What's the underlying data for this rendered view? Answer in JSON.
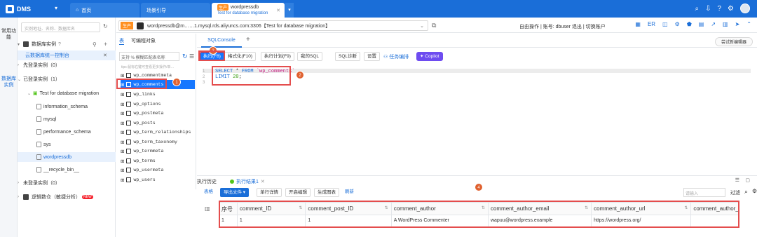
{
  "topbar": {
    "brand": "DMS",
    "tabs": [
      {
        "label": "首页"
      },
      {
        "label": "场景引导"
      },
      {
        "tag": "生产",
        "label": "wordpressdb",
        "sub": "Test for database migration"
      }
    ]
  },
  "rail": [
    "常用功能",
    "数据库实例"
  ],
  "explorer": {
    "search_placeholder": "实例地址、名称、数据库名",
    "section": "数据库实例",
    "console": "云数据库统一控制台",
    "groups": [
      {
        "label": "先登录实例（0）"
      },
      {
        "label": "已登录实例（1）"
      }
    ],
    "instance": "Test for database migration",
    "databases": [
      "information_schema",
      "mysql",
      "performance_schema",
      "sys",
      "wordpressdb",
      "__recycle_bin__"
    ],
    "unlogged": "未登录实例（0）",
    "logic": "逻辑数仓（敏捷分析）",
    "new": "NEW"
  },
  "connection": {
    "tag": "生产",
    "label": "wordpressdb@m……1.mysql.rds.aliyuncs.com:3306【Test for database migration】",
    "mode": "自由操作 | 账号: dbuser 退出 | 切换账户"
  },
  "tabs": {
    "objects": "表",
    "programmable": "可编程对象",
    "sql_console": "SQLConsole",
    "trial": "尝试新编辑器"
  },
  "object_panel": {
    "search": "支持 % 模糊匹配表名称",
    "tip": "tips:鼠标右键可查看更多操作/单…",
    "tables": [
      "wp_commentmeta",
      "wp_comments",
      "wp_links",
      "wp_options",
      "wp_postmeta",
      "wp_posts",
      "wp_term_relationships",
      "wp_term_taxonomy",
      "wp_termmeta",
      "wp_terms",
      "wp_usermeta",
      "wp_users"
    ]
  },
  "toolbar": {
    "run": "执行(F8)",
    "format": "格式化(F10)",
    "plan": "执行计划(F9)",
    "my_sql": "我的SQL",
    "diagnose": "SQL诊断",
    "settings": "设置",
    "task": "任务编排",
    "copilot": "Copilot"
  },
  "editor": {
    "lines": [
      "1",
      "2",
      "3"
    ],
    "sql_kw": "SELECT",
    "sql_star": " * ",
    "sql_from": "FROM",
    "sql_table": "`wp_comments`",
    "sql_limit": "LIMIT",
    "sql_num": "20",
    "sql_end": ";"
  },
  "results": {
    "history": "执行历史",
    "result": "执行结果1",
    "buttons": {
      "table": "表格",
      "export": "导出文件",
      "detail": "单行详情",
      "edit": "开启编辑",
      "chart": "生成图表",
      "refresh": "刷新"
    },
    "filter_placeholder": "请输入",
    "filter_label": "过滤",
    "columns": [
      "序号",
      "comment_ID",
      "comment_post_ID",
      "comment_author",
      "comment_author_email",
      "comment_author_url",
      "comment_author_IP"
    ],
    "rows": [
      [
        "1",
        "1",
        "1",
        "A WordPress Commenter",
        "wapuu@wordpress.example",
        "https://wordpress.org/",
        ""
      ]
    ]
  },
  "callouts": [
    "1",
    "2",
    "3",
    "4"
  ]
}
